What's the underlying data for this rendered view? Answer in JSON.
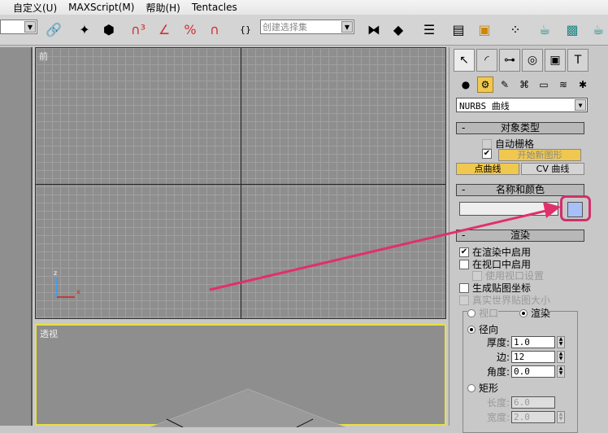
{
  "menu": [
    "自定义(U)",
    "MAXScript(M)",
    "帮助(H)",
    "Tentacles"
  ],
  "toolbar": {
    "selection_set_placeholder": "创建选择集"
  },
  "viewports": {
    "front": "前",
    "perspective": "透视"
  },
  "panel": {
    "object_category": "NURBS 曲线",
    "object_type": {
      "title": "对象类型",
      "autogrid": "自动栅格",
      "start_new_shape": "开始新图形",
      "point_curve": "点曲线",
      "cv_curve": "CV 曲线"
    },
    "name_color": {
      "title": "名称和颜色",
      "name_value": "",
      "color": "#a8c0f8"
    },
    "rendering": {
      "title": "渲染",
      "enable_render": "在渲染中启用",
      "enable_viewport": "在视口中启用",
      "use_viewport_settings": "使用视口设置",
      "gen_mapping": "生成贴图坐标",
      "real_world": "真实世界贴图大小",
      "viewport": "视口",
      "render": "渲染",
      "radial": "径向",
      "thickness_label": "厚度:",
      "thickness": "1.0",
      "sides_label": "边:",
      "sides": "12",
      "angle_label": "角度:",
      "angle": "0.0",
      "rectangular": "矩形",
      "length_label": "长度:",
      "length": "6.0",
      "width_label": "宽度:",
      "width": "2.0"
    }
  },
  "annotation": {
    "arrow_color": "#e0306a"
  }
}
